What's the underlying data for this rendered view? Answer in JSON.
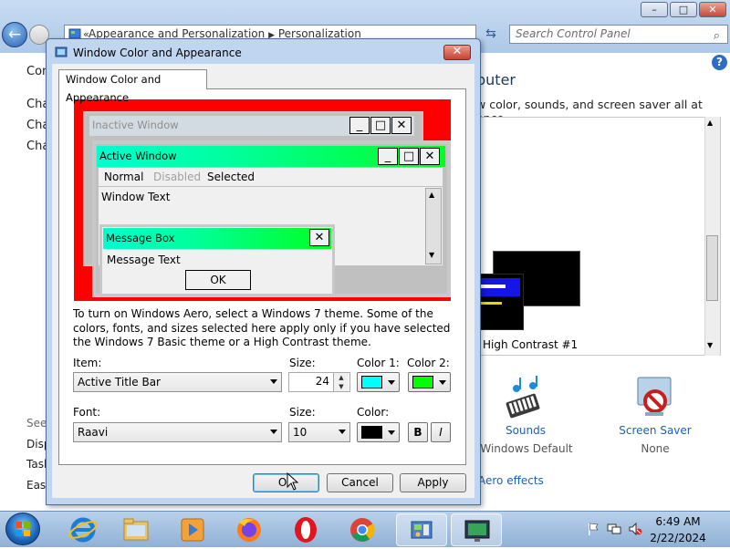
{
  "window": {
    "breadcrumb_1": "Appearance and Personalization",
    "breadcrumb_2": "Personalization",
    "search_placeholder": "Search Control Panel",
    "minimize_glyph": "–",
    "maximize_glyph": "□",
    "close_glyph": "✕"
  },
  "control_panel": {
    "left_links": [
      "Con",
      "Cha",
      "Cha",
      "Cha"
    ],
    "see_also": "See",
    "see_also_links": [
      "Disp",
      "Task",
      "Ease"
    ],
    "heading": "puter",
    "subtitle": "w color, sounds, and screen saver all at once.",
    "selected_theme_label": "High Contrast #1",
    "sounds_link": "Sounds",
    "sounds_value": "Windows Default",
    "screen_saver_link": "Screen Saver",
    "screen_saver_value": "None",
    "aero_link": "Aero effects"
  },
  "dialog": {
    "title": "Window Color and Appearance",
    "tab_label": "Window Color and Appearance",
    "preview": {
      "inactive_title": "Inactive Window",
      "active_title": "Active Window",
      "menu_normal": "Normal",
      "menu_disabled": "Disabled",
      "menu_selected": "Selected",
      "window_text": "Window Text",
      "message_box_title": "Message Box",
      "message_text": "Message Text",
      "ok_label": "OK"
    },
    "description": "To turn on Windows Aero, select a Windows 7 theme.  Some of the colors, fonts, and sizes selected here apply only if you have selected the Windows 7 Basic theme or a High Contrast theme.",
    "item_label": "Item:",
    "item_value": "Active Title Bar",
    "size_label": "Size:",
    "size_value": "24",
    "color1_label": "Color 1:",
    "color1_value": "#00ffff",
    "color2_label": "Color 2:",
    "color2_value": "#00ff00",
    "font_label": "Font:",
    "font_value": "Raavi",
    "font_size_label": "Size:",
    "font_size_value": "10",
    "font_color_label": "Color:",
    "font_color_value": "#000000",
    "bold_label": "B",
    "italic_label": "I",
    "ok_button": "OK",
    "cancel_button": "Cancel",
    "apply_button": "Apply"
  },
  "taskbar": {
    "time": "6:49 AM",
    "date": "2/22/2024",
    "apps": [
      "internet-explorer",
      "file-explorer",
      "media-player",
      "firefox",
      "opera",
      "chrome",
      "control-panel",
      "display-settings"
    ]
  }
}
